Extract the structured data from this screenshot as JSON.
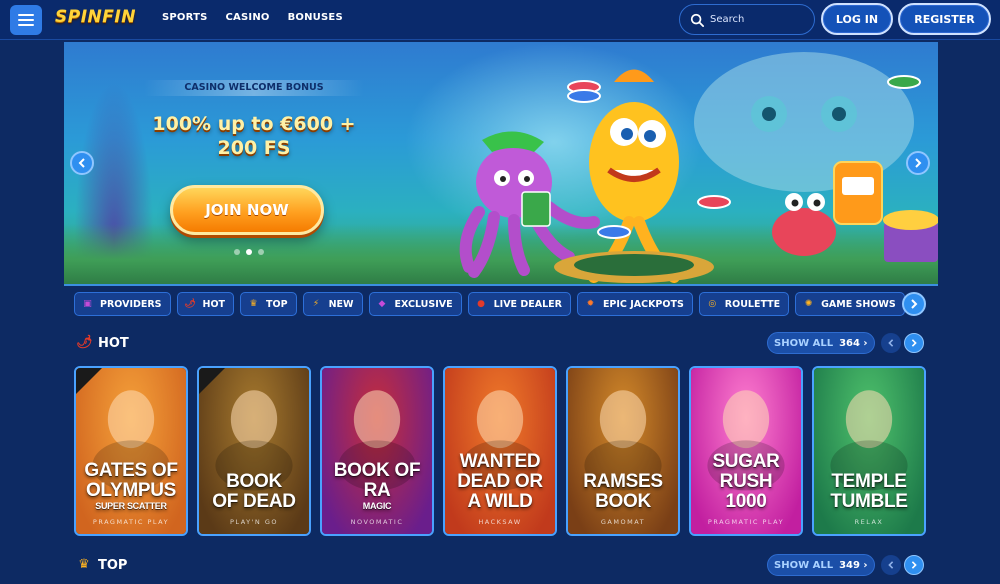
{
  "header": {
    "logo": "SPINFIN",
    "nav": [
      "SPORTS",
      "CASINO",
      "BONUSES"
    ],
    "search_placeholder": "Search",
    "login_label": "LOG IN",
    "register_label": "REGISTER"
  },
  "hero": {
    "bonus_label": "CASINO WELCOME BONUS",
    "bonus_line1": "100% up to €600 +",
    "bonus_line2": "200 FS",
    "cta_label": "JOIN NOW",
    "slides": 3,
    "active_slide": 1
  },
  "categories": [
    {
      "label": "PROVIDERS",
      "icon": "providers-icon",
      "color": "#c44bd8"
    },
    {
      "label": "HOT",
      "icon": "chili-icon",
      "color": "#e23a2a"
    },
    {
      "label": "TOP",
      "icon": "crown-icon",
      "color": "#ffb320"
    },
    {
      "label": "NEW",
      "icon": "lightning-icon",
      "color": "#ffb320"
    },
    {
      "label": "EXCLUSIVE",
      "icon": "gem-icon",
      "color": "#c44bd8"
    },
    {
      "label": "LIVE DEALER",
      "icon": "chip-icon",
      "color": "#e23a2a"
    },
    {
      "label": "EPIC JACKPOTS",
      "icon": "bomb-icon",
      "color": "#ff7a2a"
    },
    {
      "label": "ROULETTE",
      "icon": "roulette-icon",
      "color": "#ffb320"
    },
    {
      "label": "GAME SHOWS",
      "icon": "wheel-icon",
      "color": "#ffb320"
    }
  ],
  "sections": {
    "hot": {
      "title": "HOT",
      "show_all": "SHOW ALL",
      "count": "364 ›"
    },
    "top": {
      "title": "TOP",
      "show_all": "SHOW ALL",
      "count": "349 ›"
    }
  },
  "games": [
    {
      "line1": "GATES OF",
      "line2": "OLYMPUS",
      "sub": "SUPER SCATTER",
      "provider": "PRAGMATIC PLAY",
      "bg1": "#f5a13a",
      "bg2": "#d1651f",
      "badge": true
    },
    {
      "line1": "BOOK",
      "line2": "OF DEAD",
      "sub": "",
      "provider": "PLAY'N GO",
      "bg1": "#a77a2e",
      "bg2": "#5b3a17",
      "badge": true
    },
    {
      "line1": "BOOK OF RA",
      "line2": "",
      "sub": "MAGIC",
      "provider": "NOVOMATIC",
      "bg1": "#c72e3a",
      "bg2": "#6a1e8c",
      "badge": false
    },
    {
      "line1": "WANTED",
      "line2": "DEAD OR A WILD",
      "sub": "",
      "provider": "HACKSAW",
      "bg1": "#f07a2a",
      "bg2": "#c13a1c",
      "badge": false
    },
    {
      "line1": "RAMSES BOOK",
      "line2": "",
      "sub": "",
      "provider": "GAMOMAT",
      "bg1": "#d48a2a",
      "bg2": "#7a3f16",
      "badge": false
    },
    {
      "line1": "SUGAR RUSH",
      "line2": "1000",
      "sub": "",
      "provider": "PRAGMATIC PLAY",
      "bg1": "#ff7fd0",
      "bg2": "#c21fa0",
      "badge": false
    },
    {
      "line1": "TEMPLE",
      "line2": "TUMBLE",
      "sub": "",
      "provider": "RELAX",
      "bg1": "#4fc26c",
      "bg2": "#1d7a4a",
      "badge": false
    }
  ]
}
